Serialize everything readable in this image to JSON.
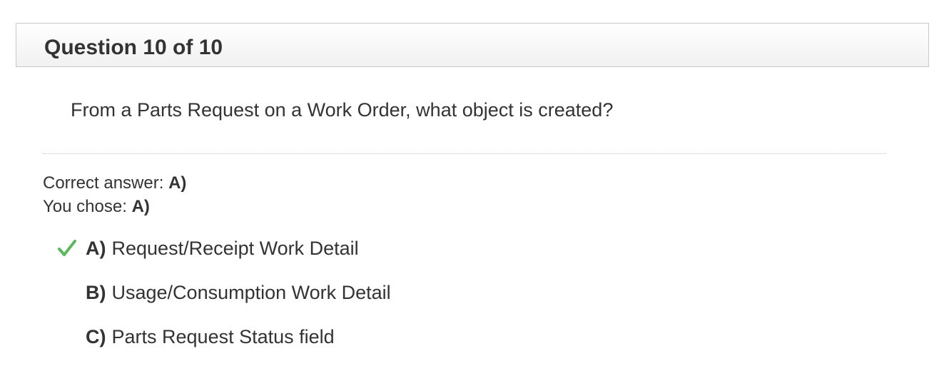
{
  "header": {
    "title": "Question 10 of 10"
  },
  "question": {
    "text": "From a Parts Request on a Work Order, what object is created?"
  },
  "result": {
    "correct_label": "Correct answer:",
    "correct_value": "A)",
    "chose_label": "You chose:",
    "chose_value": "A)"
  },
  "options": [
    {
      "letter": "A)",
      "text": "Request/Receipt Work Detail",
      "checked": true
    },
    {
      "letter": "B)",
      "text": "Usage/Consumption Work Detail",
      "checked": false
    },
    {
      "letter": "C)",
      "text": "Parts Request Status field",
      "checked": false
    }
  ],
  "colors": {
    "check": "#5cb85c",
    "text": "#333333",
    "border": "#c8c8c8"
  },
  "icons": {
    "correct_mark": "checkmark-icon"
  }
}
